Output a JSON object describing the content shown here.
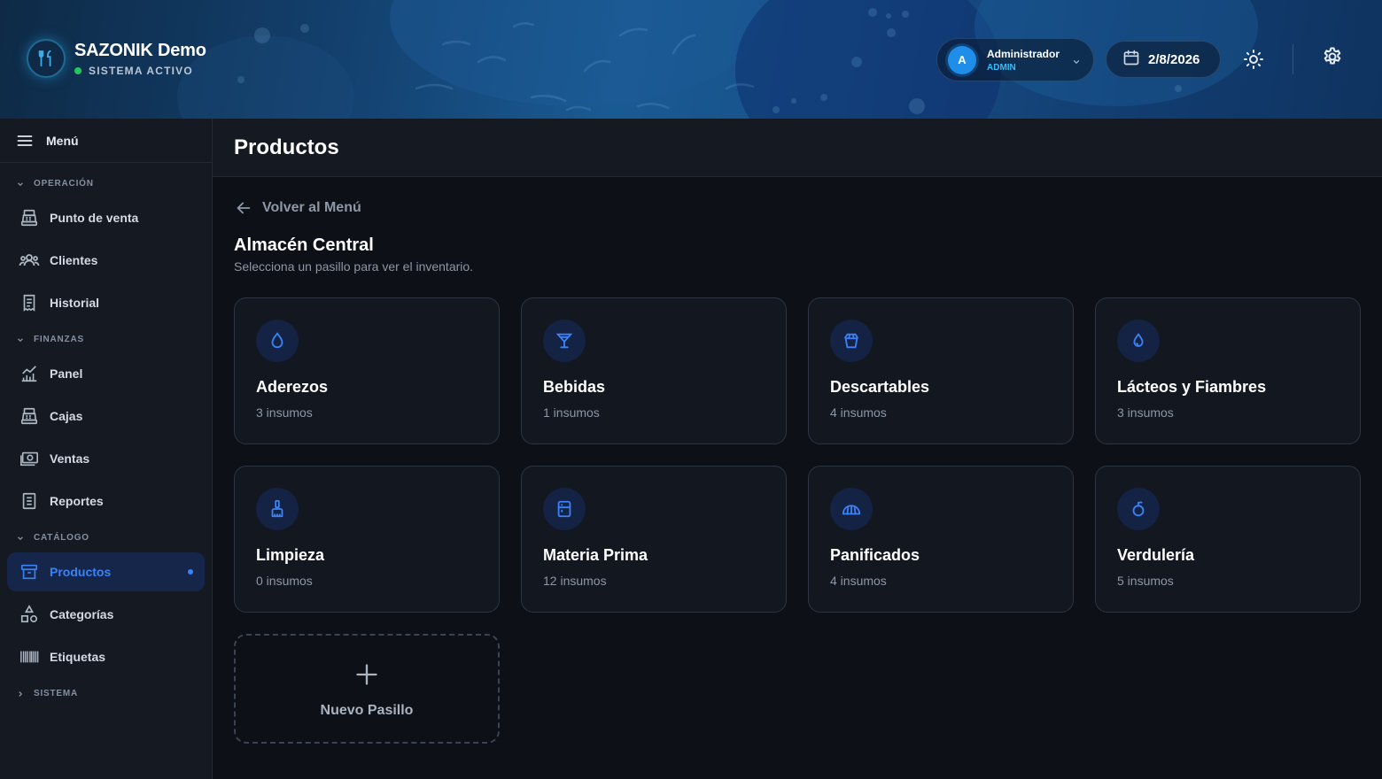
{
  "header": {
    "brand_title": "SAZONIK Demo",
    "brand_status": "SISTEMA ACTIVO",
    "user_name": "Administrador",
    "user_role": "ADMIN",
    "avatar_initial": "A",
    "date": "2/8/2026",
    "icons": {
      "logo": "utensils-icon",
      "calendar": "calendar-icon",
      "theme": "sun-icon",
      "settings": "gear-icon"
    }
  },
  "sidebar": {
    "menu_label": "Menú",
    "sections": [
      {
        "label": "OPERACIÓN",
        "expanded": true
      },
      {
        "label": "FINANZAS",
        "expanded": true
      },
      {
        "label": "CATÁLOGO",
        "expanded": true
      },
      {
        "label": "SISTEMA",
        "expanded": false
      }
    ],
    "items": [
      {
        "label": "Punto de venta",
        "icon": "register-icon"
      },
      {
        "label": "Clientes",
        "icon": "users-icon"
      },
      {
        "label": "Historial",
        "icon": "receipt-icon"
      },
      {
        "label": "Panel",
        "icon": "chart-icon"
      },
      {
        "label": "Cajas",
        "icon": "register-icon"
      },
      {
        "label": "Ventas",
        "icon": "cash-icon"
      },
      {
        "label": "Reportes",
        "icon": "report-icon"
      },
      {
        "label": "Productos",
        "icon": "archive-icon",
        "active": true
      },
      {
        "label": "Categorías",
        "icon": "shapes-icon"
      },
      {
        "label": "Etiquetas",
        "icon": "barcode-icon"
      }
    ]
  },
  "main": {
    "page_title": "Productos",
    "back_label": "Volver al Menú",
    "section_title": "Almacén Central",
    "section_subtitle": "Selecciona un pasillo para ver el inventario.",
    "aisles": [
      {
        "name": "Aderezos",
        "count": "3 insumos",
        "icon": "drop-icon"
      },
      {
        "name": "Bebidas",
        "count": "1 insumos",
        "icon": "cocktail-icon"
      },
      {
        "name": "Descartables",
        "count": "4 insumos",
        "icon": "takeout-box-icon"
      },
      {
        "name": "Lácteos y Fiambres",
        "count": "3 insumos",
        "icon": "milk-drop-icon"
      },
      {
        "name": "Limpieza",
        "count": "0 insumos",
        "icon": "brush-icon"
      },
      {
        "name": "Materia Prima",
        "count": "12 insumos",
        "icon": "fridge-icon"
      },
      {
        "name": "Panificados",
        "count": "4 insumos",
        "icon": "bread-icon"
      },
      {
        "name": "Verdulería",
        "count": "5 insumos",
        "icon": "apple-icon"
      }
    ],
    "new_aisle_label": "Nuevo Pasillo"
  },
  "colors": {
    "accent": "#3b82f6",
    "status_active": "#22c55e",
    "role_color": "#38bdf8",
    "background": "#0d1016",
    "card_border": "#2d3543"
  }
}
